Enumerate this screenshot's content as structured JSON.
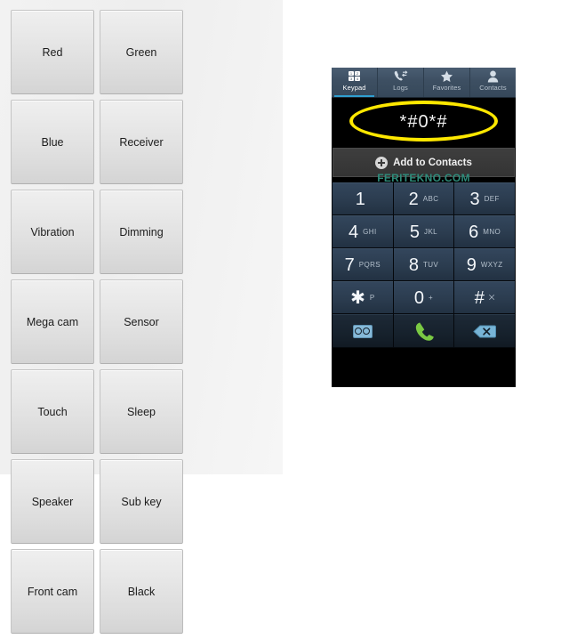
{
  "test_grid": {
    "name": "service-mode-test-grid",
    "buttons": [
      "Red",
      "Green",
      "Blue",
      "Receiver",
      "Vibration",
      "Dimming",
      "Mega cam",
      "Sensor",
      "Touch",
      "Sleep",
      "Speaker",
      "Sub key",
      "Front cam",
      "Black"
    ]
  },
  "dialer": {
    "tabs": [
      {
        "label": "Keypad",
        "icon": "keypad-icon",
        "active": true
      },
      {
        "label": "Logs",
        "icon": "call-log-icon",
        "active": false
      },
      {
        "label": "Favorites",
        "icon": "star-icon",
        "active": false
      },
      {
        "label": "Contacts",
        "icon": "person-icon",
        "active": false
      }
    ],
    "keypad_icon_digits": [
      "1",
      "2",
      "3",
      "4"
    ],
    "display": {
      "dialed_number": "*#0*#",
      "highlight_color": "#ffe800"
    },
    "add_to_contacts": {
      "label": "Add to Contacts",
      "icon": "plus-circle-icon"
    },
    "watermark": {
      "text": "FERITEKNO.COM",
      "color": "#2e8b7a"
    },
    "keys": [
      {
        "digit": "1",
        "sub": ""
      },
      {
        "digit": "2",
        "sub": "ABC"
      },
      {
        "digit": "3",
        "sub": "DEF"
      },
      {
        "digit": "4",
        "sub": "GHI"
      },
      {
        "digit": "5",
        "sub": "JKL"
      },
      {
        "digit": "6",
        "sub": "MNO"
      },
      {
        "digit": "7",
        "sub": "PQRS"
      },
      {
        "digit": "8",
        "sub": "TUV"
      },
      {
        "digit": "9",
        "sub": "WXYZ"
      },
      {
        "digit": "✱",
        "sub": "P"
      },
      {
        "digit": "0",
        "sub": "+"
      },
      {
        "digit": "#",
        "sub": "⨉"
      }
    ],
    "function_keys": [
      {
        "name": "voicemail-button",
        "icon": "voicemail-icon"
      },
      {
        "name": "call-button",
        "icon": "phone-handset-icon",
        "color": "#7ac943"
      },
      {
        "name": "backspace-button",
        "icon": "backspace-icon",
        "color": "#77b4d6"
      }
    ]
  }
}
